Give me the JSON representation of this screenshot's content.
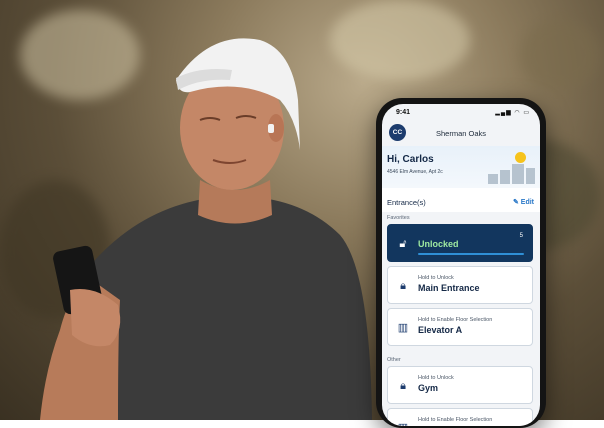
{
  "phone": {
    "status": {
      "time": "9:41",
      "icons": "▂▄▆ ◠ ▭"
    },
    "header": {
      "avatar_initials": "CC",
      "location": "Sherman Oaks"
    },
    "greeting": {
      "title": "Hi, Carlos",
      "address": "4546 Elm Avenue, Apt 2c"
    },
    "entrances": {
      "title": "Entrance(s)",
      "edit_label": "✎ Edit"
    },
    "favorites_label": "Favorites",
    "other_label": "Other",
    "cards": [
      {
        "subtitle": "",
        "title": "Unlocked",
        "count": "5",
        "icon": "unlock-icon",
        "active": true
      },
      {
        "subtitle": "Hold to Unlock",
        "title": "Main Entrance",
        "icon": "lock-icon"
      },
      {
        "subtitle": "Hold to Enable Floor Selection",
        "title": "Elevator A",
        "icon": "elevator-icon"
      },
      {
        "subtitle": "Hold to Unlock",
        "title": "Gym",
        "icon": "lock-icon"
      },
      {
        "subtitle": "Hold to Enable Floor Selection",
        "title": "",
        "icon": "elevator-icon"
      }
    ]
  }
}
